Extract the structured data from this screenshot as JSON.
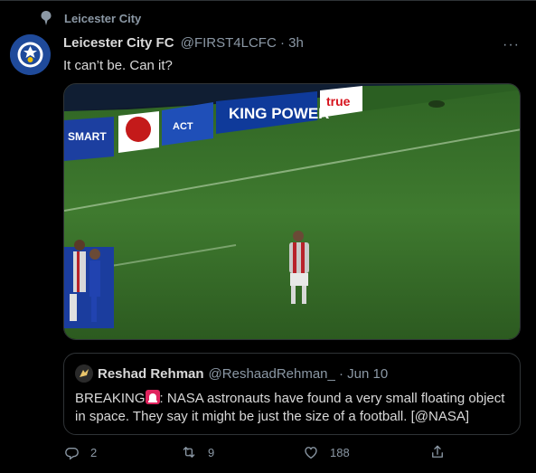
{
  "social_context": {
    "text": "Leicester City",
    "icon": "pin-icon"
  },
  "tweet": {
    "author_name": "Leicester City FC",
    "author_meta": "@FIRST4LCFC · 3h",
    "more_label": "···",
    "text": "It can’t be. Can it?",
    "media": {
      "ad_boards": [
        "SMART",
        "ACT",
        "KING POWER",
        "true"
      ]
    }
  },
  "quote": {
    "author_name": "Reshad Rehman",
    "author_meta": "@ReshaadRehman_ · Jun 10",
    "text_before": "BREAKING",
    "text_after": ": NASA astronauts have found a very small floating object in space. They say it might be just the size of a football. [@NASA]"
  },
  "actions": {
    "reply_count": "2",
    "retweet_count": "9",
    "like_count": "188"
  },
  "colors": {
    "background": "#000000",
    "text": "#d9d9d9",
    "secondary": "#8b98a5",
    "border": "#2f3336",
    "pitch": "#3f7a2f"
  }
}
